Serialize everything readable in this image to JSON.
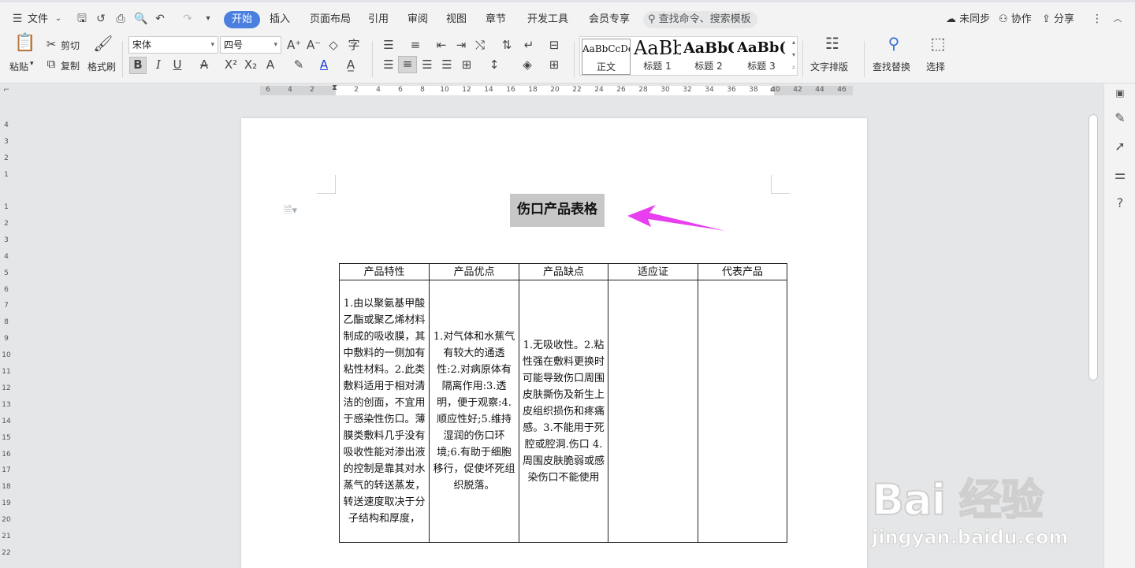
{
  "menu": {
    "file_label": "文件",
    "tabs": [
      "开始",
      "插入",
      "页面布局",
      "引用",
      "审阅",
      "视图",
      "章节",
      "开发工具",
      "会员专享"
    ],
    "search_placeholder": "查找命令、搜索模板",
    "sync_label": "未同步",
    "collab_label": "协作",
    "share_label": "分享"
  },
  "ribbon": {
    "paste_label": "粘贴",
    "cut_label": "剪切",
    "copy_label": "复制",
    "format_painter_label": "格式刷",
    "font_name": "宋体",
    "font_size": "四号",
    "styles": [
      {
        "sample": "AaBbCcDd",
        "name": "正文"
      },
      {
        "sample": "AaBb",
        "name": "标题 1"
      },
      {
        "sample": "AaBbC",
        "name": "标题 2"
      },
      {
        "sample": "AaBb(",
        "name": "标题 3"
      }
    ],
    "text_layout_label": "文字排版",
    "find_replace_label": "查找替换",
    "select_label": "选择"
  },
  "ruler": {
    "h_numbers": [
      "6",
      "4",
      "2",
      "",
      "2",
      "4",
      "6",
      "8",
      "10",
      "12",
      "14",
      "16",
      "18",
      "20",
      "22",
      "24",
      "26",
      "28",
      "30",
      "32",
      "34",
      "36",
      "38",
      "40",
      "42",
      "44",
      "46"
    ],
    "v_numbers": [
      "4",
      "3",
      "2",
      "1",
      "1",
      "2",
      "3",
      "4",
      "5",
      "6",
      "7",
      "8",
      "9",
      "10",
      "11",
      "12",
      "13",
      "14",
      "15",
      "16",
      "17",
      "18",
      "19",
      "20",
      "21",
      "22"
    ]
  },
  "document": {
    "title": "伤口产品表格",
    "table": {
      "headers": [
        "产品特性",
        "产品优点",
        "产品缺点",
        "适应证",
        "代表产品"
      ],
      "cells": [
        "1.由以聚氨基甲酸乙酯或聚乙烯材料制成的吸收膜，其中敷料的一侧加有粘性材料。2.此类敷料适用于相对清洁的创面，不宜用于感染性伤口。薄膜类敷料几乎没有吸收性能对渗出液的控制是靠其对水蒸气的转送蒸发，转送速度取决于分子结构和厚度，",
        "1.对气体和水蕉气有较大的通透性:2.对病原体有隔离作用:3.透明，便于观察:4.顺应性好;5.维持湿润的伤口环境;6.有助于细胞移行，促使坏死组织脱落。",
        "1.无吸收性。2.粘性强在敷料更换时可能导致伤口周围皮肤撕伤及新生上皮组织损伤和疼痛感。3.不能用于死腔或腔洞.伤口 4.周围皮肤脆弱或感染伤口不能使用",
        "",
        ""
      ]
    }
  },
  "watermark": {
    "brand": "Bai 经验",
    "url": "jingyan.baidu.com"
  },
  "colors": {
    "accent": "#4a7fe0",
    "arrow": "#e83ef0",
    "title_highlight": "#c7c7c7"
  }
}
